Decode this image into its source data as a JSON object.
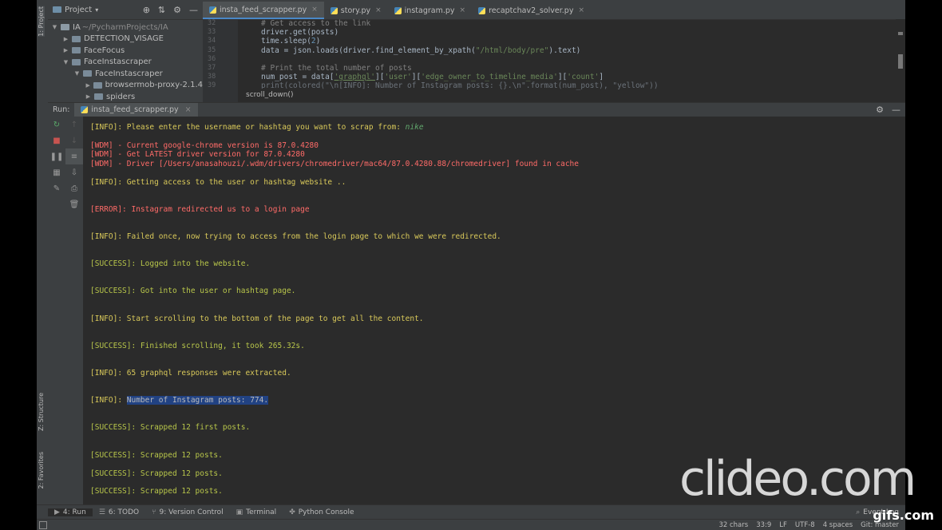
{
  "left_stripe": {
    "top_label": "1: Project",
    "mid_label": "Z: Structure",
    "bottom_label": "2: Favorites"
  },
  "project": {
    "title": "Project",
    "tree": [
      {
        "label": "IA",
        "hint": "~/PycharmProjects/IA"
      },
      {
        "label": "DETECTION_VISAGE"
      },
      {
        "label": "FaceFocus"
      },
      {
        "label": "FaceInstascraper"
      },
      {
        "label": "FaceInstascraper"
      },
      {
        "label": "browsermob-proxy-2.1.4"
      },
      {
        "label": "spiders"
      }
    ]
  },
  "editor": {
    "tabs": [
      "insta_feed_scrapper.py",
      "story.py",
      "instagram.py",
      "recaptchav2_solver.py"
    ],
    "line_numbers": [
      "32",
      "33",
      "34",
      "35",
      "36",
      "37",
      "38",
      "39"
    ],
    "code": {
      "l1": "# Get access to the link",
      "l2": "driver.get(posts)",
      "l3a": "time.sleep(",
      "l3b": "2",
      "l3c": ")",
      "l4a": "data = json.loads(driver.find_element_by_xpath(",
      "l4b": "\"/html/body/pre\"",
      "l4c": ").text)",
      "l5": "# Print the total number of posts",
      "l6a": "num_post = data[",
      "l6b": "'graphql'",
      "l6c": "][",
      "l6d": "'user'",
      "l6e": "][",
      "l6f": "'edge_owner_to_timeline_media'",
      "l6g": "][",
      "l6h": "'count'",
      "l6i": "]",
      "l7": "print(colored(\"\\n[INFO]: Number of Instagram posts: {}.\\n\".format(num_post), \"yellow\"))"
    },
    "breadcrumb": "scroll_down()"
  },
  "run": {
    "label": "Run:",
    "tab": "insta_feed_scrapper.py"
  },
  "console": {
    "l01a": "[INFO]: Please enter the username or hashtag you want to scrap from: ",
    "l01b": "nike",
    "l02": "[WDM] - Current google-chrome version is 87.0.4280",
    "l03": "[WDM] - Get LATEST driver version for 87.0.4280",
    "l04": "[WDM] - Driver [/Users/anasahouzi/.wdm/drivers/chromedriver/mac64/87.0.4280.88/chromedriver] found in cache",
    "l05": "[INFO]: Getting access to the user or hashtag website ..",
    "l06": "[ERROR]: Instagram redirected us to a login page",
    "l07": "[INFO]: Failed once, now trying to access from the login page to which we were redirected.",
    "l08": "[SUCCESS]: Logged into the website.",
    "l09": "[SUCCESS]: Got into the user or hashtag page.",
    "l10": "[INFO]: Start scrolling to the bottom of the page to get all the content.",
    "l11": "[SUCCESS]: Finished scrolling, it took 265.32s.",
    "l12": "[INFO]: 65 graphql responses were extracted.",
    "l13a": "[INFO]: ",
    "l13b": "Number of Instagram posts: 774.",
    "l14": "[SUCCESS]: Scrapped 12 first posts.",
    "l15": "[SUCCESS]: Scrapped 12 posts.",
    "l16": "[SUCCESS]: Scrapped 12 posts.",
    "l17": "[SUCCESS]: Scrapped 12 posts."
  },
  "tool_windows": {
    "run": "4: Run",
    "todo": "6: TODO",
    "vcs": "9: Version Control",
    "terminal": "Terminal",
    "python_console": "Python Console",
    "event_log": "Event Log"
  },
  "status": {
    "chars": "32 chars",
    "pos": "33:9",
    "lf": "LF",
    "encoding": "UTF-8",
    "indent": "4 spaces",
    "git": "Git: master"
  },
  "watermark": {
    "clideo": "clideo.com",
    "gifs": "gifs.com"
  },
  "colors": {
    "info": "#d9c95a",
    "error": "#ff6b68",
    "success": "#b8c64a",
    "selection": "#214283"
  }
}
